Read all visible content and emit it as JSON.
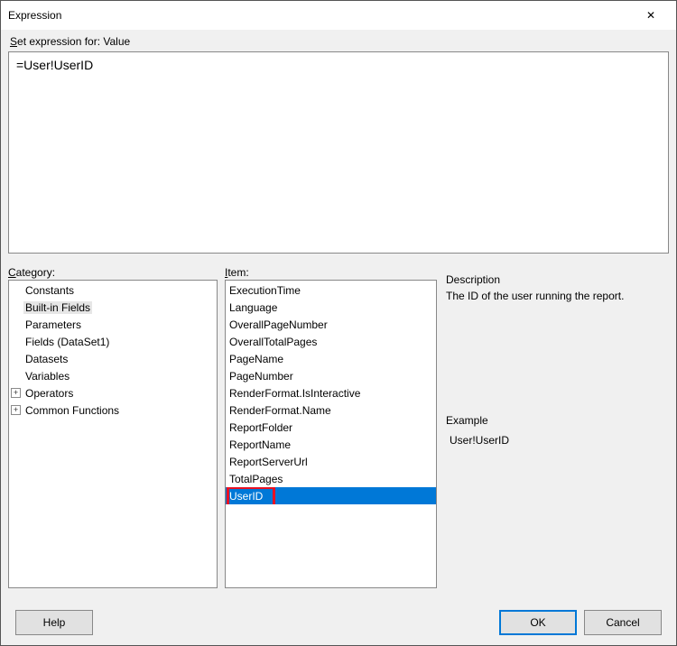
{
  "window": {
    "title": "Expression"
  },
  "set_label_prefix": "S",
  "set_label_rest": "et expression for: Value",
  "expression_value": "=User!UserID",
  "category_label_u": "C",
  "category_label_rest": "ategory:",
  "item_label_u": "I",
  "item_label_rest": "tem:",
  "categories": [
    {
      "label": "Constants",
      "expandable": false,
      "selected": false
    },
    {
      "label": "Built-in Fields",
      "expandable": false,
      "selected": true
    },
    {
      "label": "Parameters",
      "expandable": false,
      "selected": false
    },
    {
      "label": "Fields (DataSet1)",
      "expandable": false,
      "selected": false
    },
    {
      "label": "Datasets",
      "expandable": false,
      "selected": false
    },
    {
      "label": "Variables",
      "expandable": false,
      "selected": false
    },
    {
      "label": "Operators",
      "expandable": true,
      "selected": false
    },
    {
      "label": "Common Functions",
      "expandable": true,
      "selected": false
    }
  ],
  "items": [
    {
      "label": "ExecutionTime",
      "selected": false
    },
    {
      "label": "Language",
      "selected": false
    },
    {
      "label": "OverallPageNumber",
      "selected": false
    },
    {
      "label": "OverallTotalPages",
      "selected": false
    },
    {
      "label": "PageName",
      "selected": false
    },
    {
      "label": "PageNumber",
      "selected": false
    },
    {
      "label": "RenderFormat.IsInteractive",
      "selected": false
    },
    {
      "label": "RenderFormat.Name",
      "selected": false
    },
    {
      "label": "ReportFolder",
      "selected": false
    },
    {
      "label": "ReportName",
      "selected": false
    },
    {
      "label": "ReportServerUrl",
      "selected": false
    },
    {
      "label": "TotalPages",
      "selected": false
    },
    {
      "label": "UserID",
      "selected": true
    }
  ],
  "description": {
    "title": "Description",
    "text": "The ID of the user running the report."
  },
  "example": {
    "title": "Example",
    "text": "User!UserID"
  },
  "buttons": {
    "help": "Help",
    "ok": "OK",
    "cancel": "Cancel"
  },
  "glyphs": {
    "close": "✕",
    "plus": "+"
  }
}
